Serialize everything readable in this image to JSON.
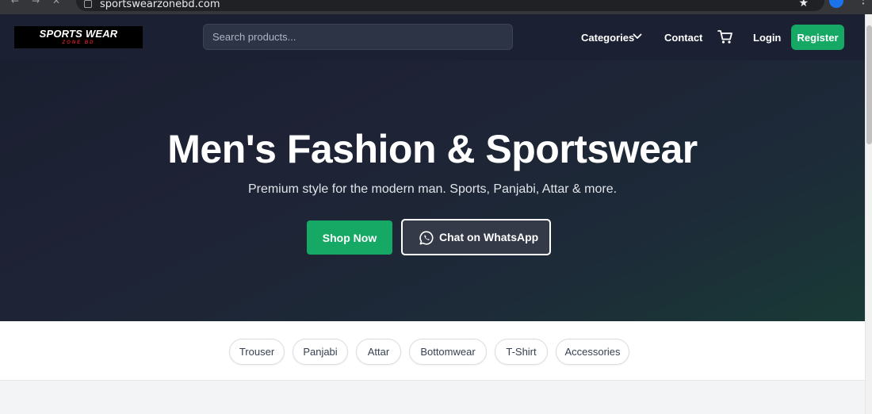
{
  "browser": {
    "url": "sportswearzonebd.com"
  },
  "header": {
    "logo": {
      "line1": "SPORTS WEAR",
      "line2": "ZONE BD"
    },
    "search_placeholder": "Search products...",
    "nav": {
      "categories": "Categories",
      "contact": "Contact",
      "login": "Login",
      "register": "Register"
    }
  },
  "hero": {
    "title": "Men's Fashion & Sportswear",
    "subtitle": "Premium style for the modern man. Sports, Panjabi, Attar & more.",
    "shop_button": "Shop Now",
    "whatsapp_button": "Chat on WhatsApp"
  },
  "categories": [
    {
      "label": "Trouser"
    },
    {
      "label": "Panjabi"
    },
    {
      "label": "Attar"
    },
    {
      "label": "Bottomwear"
    },
    {
      "label": "T-Shirt"
    },
    {
      "label": "Accessories"
    }
  ],
  "colors": {
    "header_bg": "#1b2032",
    "accent_green": "#16a965",
    "logo_red": "#d11f2a"
  },
  "icons": {
    "cart": "cart-icon",
    "chevron": "chevron-down-icon",
    "whatsapp": "whatsapp-icon"
  }
}
